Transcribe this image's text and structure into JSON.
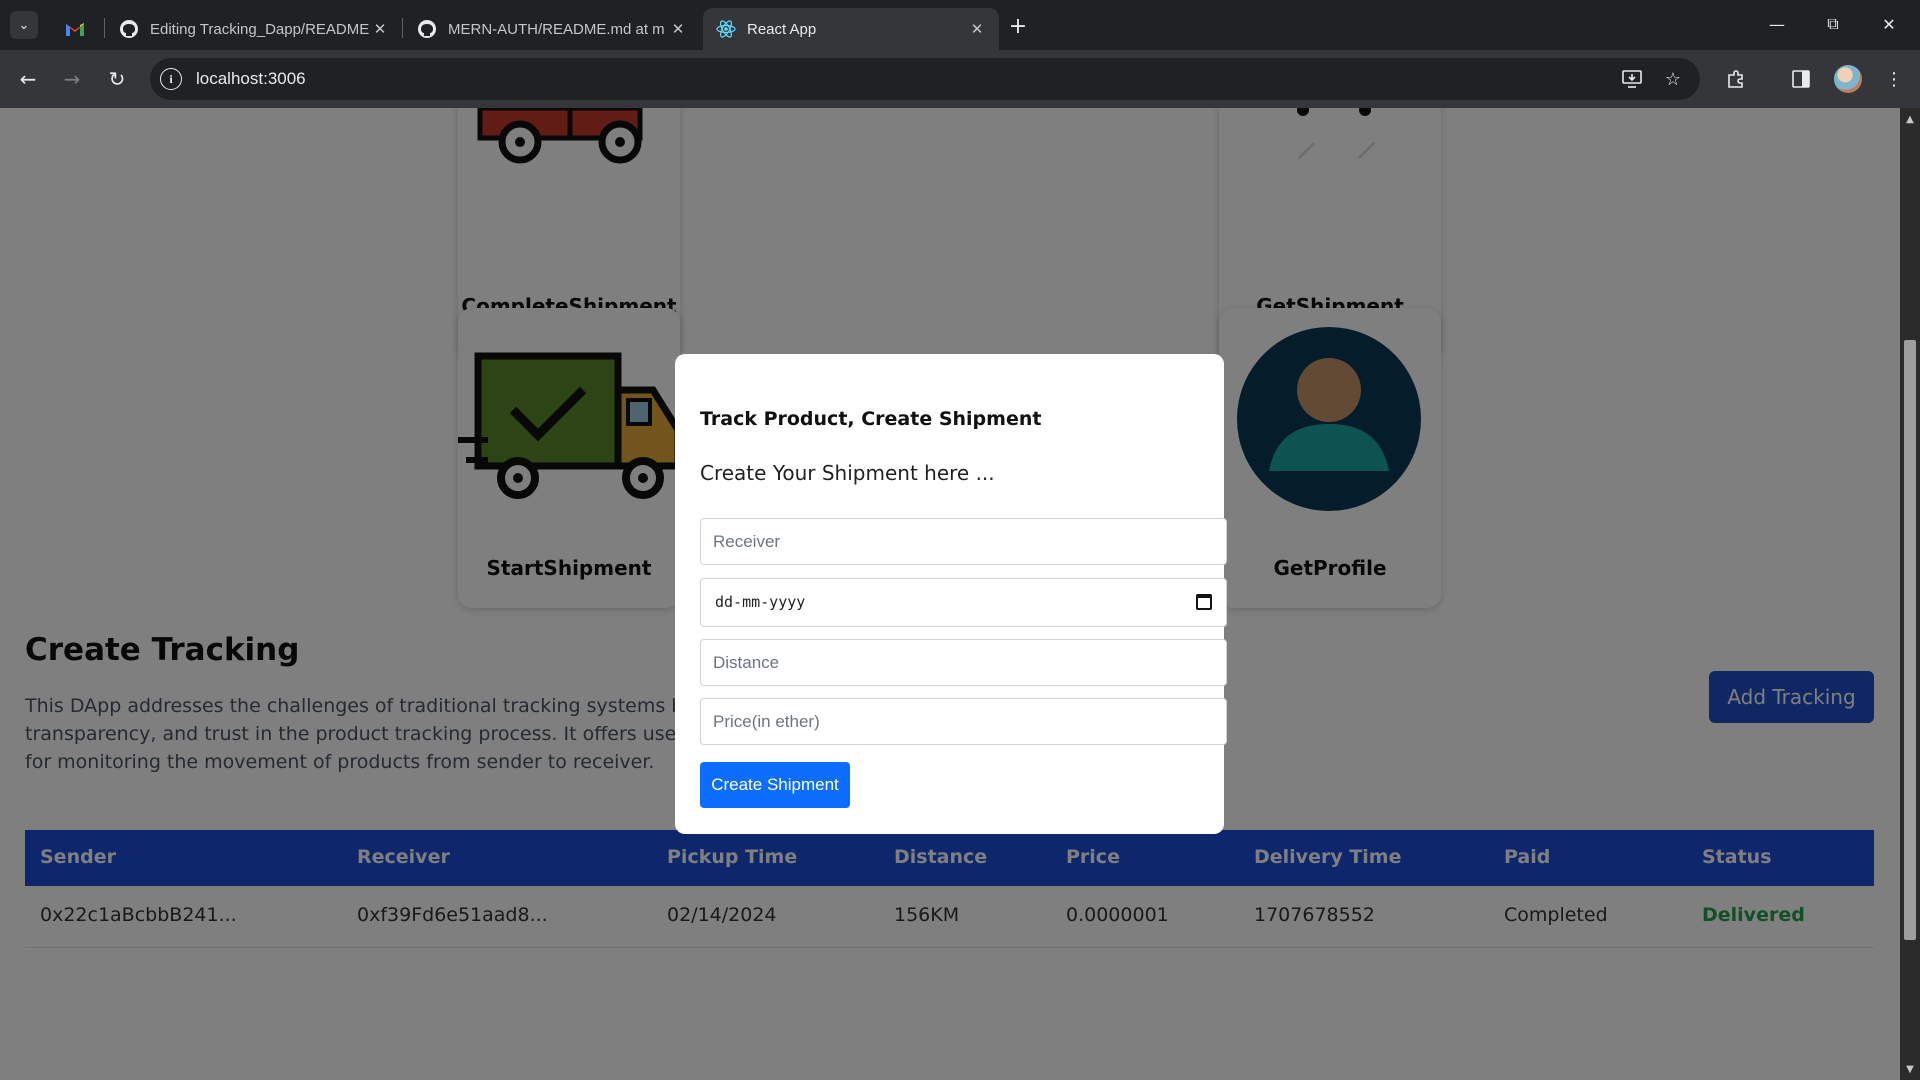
{
  "browser": {
    "tabs": [
      {
        "label": "",
        "icon": "gmail-icon"
      },
      {
        "label": "Editing Tracking_Dapp/README",
        "icon": "github-icon"
      },
      {
        "label": "MERN-AUTH/README.md at m",
        "icon": "github-icon"
      },
      {
        "label": "React App",
        "icon": "react-icon"
      }
    ],
    "url": "localhost:3006"
  },
  "services": [
    {
      "label": "CompleteShipment",
      "icon": "truck-icon"
    },
    {
      "label": "GetShipment",
      "icon": "shipment-icon"
    },
    {
      "label": "StartShipment",
      "icon": "delivery-truck-check-icon"
    },
    {
      "label": "GetProfile",
      "icon": "user-avatar-icon"
    }
  ],
  "tracking": {
    "title": "Create Tracking",
    "description": "This DApp addresses the challenges of traditional tracking systems by leve provide enhanced security, transparency, and trust in the product tracking process. It offers users a reliable and efficient solution for monitoring the movement of products from sender to receiver.",
    "add_button": "Add Tracking"
  },
  "table": {
    "headers": [
      "Sender",
      "Receiver",
      "Pickup Time",
      "Distance",
      "Price",
      "Delivery Time",
      "Paid",
      "Status"
    ],
    "rows": [
      [
        "0x22c1aBcbbB241...",
        "0xf39Fd6e51aad8...",
        "02/14/2024",
        "156KM",
        "0.0000001",
        "1707678552",
        "Completed",
        "Delivered"
      ]
    ]
  },
  "modal": {
    "title": "Track Product, Create Shipment",
    "subtitle": "Create Your Shipment here ...",
    "receiver_placeholder": "Receiver",
    "date_placeholder": "dd-mm-yyyy",
    "distance_placeholder": "Distance",
    "price_placeholder": "Price(in ether)",
    "submit": "Create Shipment"
  },
  "colors": {
    "accent": "#0d6efd",
    "table_header": "#1d4ed8",
    "status_delivered": "#22a04a"
  }
}
